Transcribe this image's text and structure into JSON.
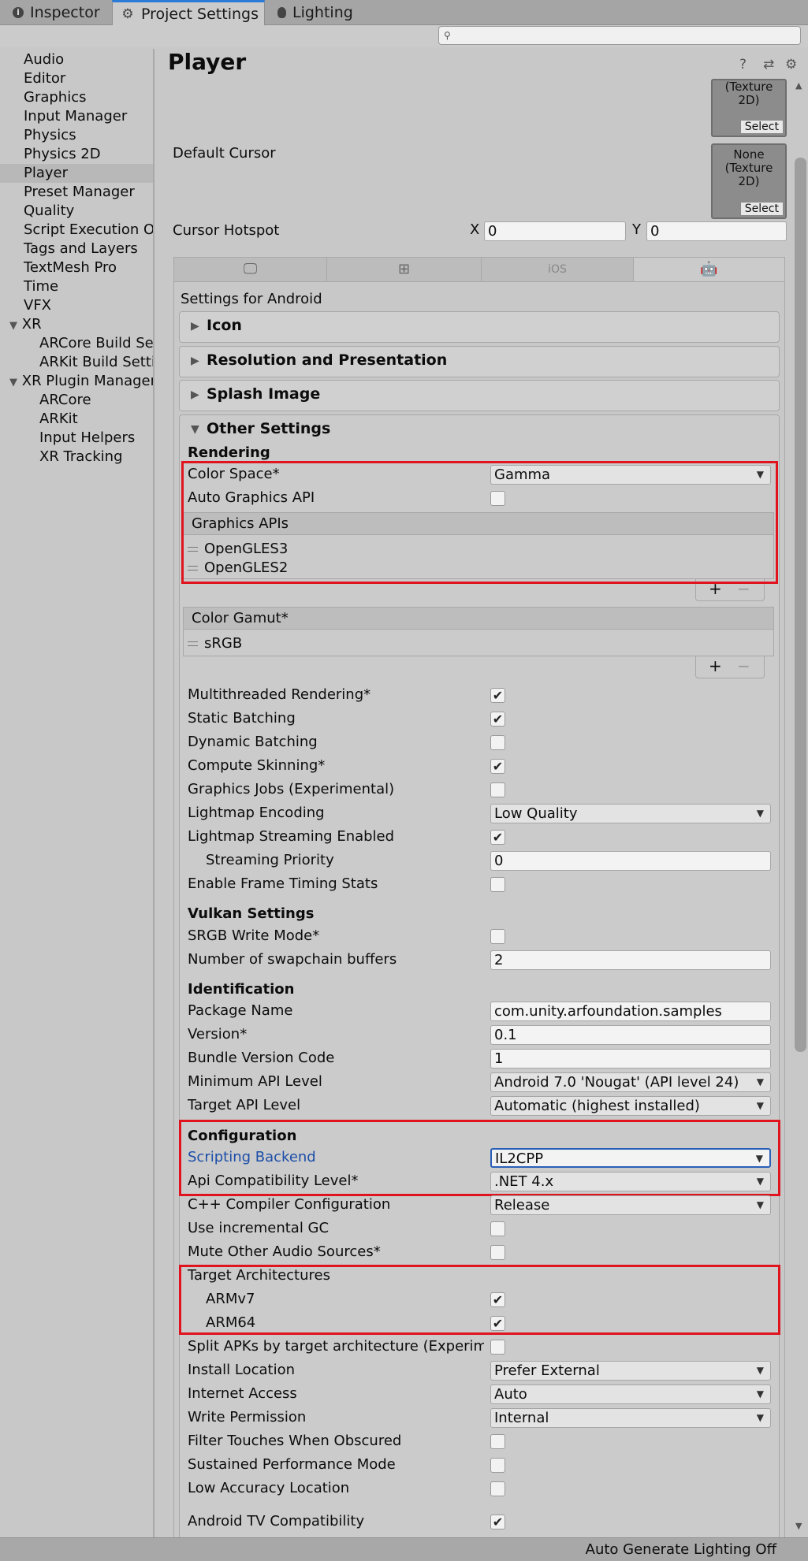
{
  "tabs": [
    {
      "label": "Inspector",
      "icon": "info-icon"
    },
    {
      "label": "Project Settings",
      "icon": "gear-icon"
    },
    {
      "label": "Lighting",
      "icon": "bulb-icon"
    }
  ],
  "search": {
    "placeholder": ""
  },
  "sidebar": {
    "items": [
      "Audio",
      "Editor",
      "Graphics",
      "Input Manager",
      "Physics",
      "Physics 2D",
      "Player",
      "Preset Manager",
      "Quality",
      "Script Execution Or",
      "Tags and Layers",
      "TextMesh Pro",
      "Time",
      "VFX"
    ],
    "xr": {
      "label": "XR",
      "children": [
        "ARCore Build Set",
        "ARKit Build Settin"
      ]
    },
    "xr_plugin": {
      "label": "XR Plugin Manager",
      "children": [
        "ARCore",
        "ARKit",
        "Input Helpers",
        "XR Tracking"
      ]
    },
    "selected": "Player"
  },
  "header": {
    "title": "Player",
    "help": "?",
    "preset": "⇄",
    "settings": "⚙"
  },
  "top": {
    "texture_top": "(Texture 2D)",
    "select": "Select",
    "default_cursor": "Default Cursor",
    "cursor_tex_line1": "None",
    "cursor_tex_line2": "(Texture 2D)",
    "cursor_hotspot": "Cursor Hotspot",
    "x_label": "X",
    "x_value": "0",
    "y_label": "Y",
    "y_value": "0"
  },
  "platform_tabs": [
    "desktop-icon",
    "windows-icon",
    "iOS",
    "android-icon"
  ],
  "settings_for": "Settings for Android",
  "foldouts": {
    "icon": "Icon",
    "resolution": "Resolution and Presentation",
    "splash": "Splash Image",
    "other": "Other Settings"
  },
  "rendering": {
    "header": "Rendering",
    "color_space": {
      "label": "Color Space*",
      "value": "Gamma"
    },
    "auto_graphics": "Auto Graphics API",
    "graphics_apis": {
      "header": "Graphics APIs",
      "items": [
        "OpenGLES3",
        "OpenGLES2"
      ]
    },
    "color_gamut": {
      "header": "Color Gamut*",
      "items": [
        "sRGB"
      ]
    },
    "plus": "+",
    "minus": "−",
    "rows": [
      {
        "label": "Multithreaded Rendering*",
        "checked": true
      },
      {
        "label": "Static Batching",
        "checked": true
      },
      {
        "label": "Dynamic Batching",
        "checked": false
      },
      {
        "label": "Compute Skinning*",
        "checked": true
      },
      {
        "label": "Graphics Jobs (Experimental)",
        "checked": false
      }
    ],
    "lightmap_encoding": {
      "label": "Lightmap Encoding",
      "value": "Low Quality"
    },
    "lightmap_streaming": {
      "label": "Lightmap Streaming Enabled",
      "checked": true
    },
    "streaming_priority": {
      "label": "Streaming Priority",
      "value": "0"
    },
    "frame_timing": {
      "label": "Enable Frame Timing Stats",
      "checked": false
    }
  },
  "vulkan": {
    "header": "Vulkan Settings",
    "srgb": {
      "label": "SRGB Write Mode*",
      "checked": false
    },
    "swapchain": {
      "label": "Number of swapchain buffers",
      "value": "2"
    }
  },
  "identification": {
    "header": "Identification",
    "package": {
      "label": "Package Name",
      "value": "com.unity.arfoundation.samples"
    },
    "version": {
      "label": "Version*",
      "value": "0.1"
    },
    "bundle": {
      "label": "Bundle Version Code",
      "value": "1"
    },
    "min_api": {
      "label": "Minimum API Level",
      "value": "Android 7.0 'Nougat' (API level 24)"
    },
    "target_api": {
      "label": "Target API Level",
      "value": "Automatic (highest installed)"
    }
  },
  "configuration": {
    "header": "Configuration",
    "scripting": {
      "label": "Scripting Backend",
      "value": "IL2CPP"
    },
    "api_compat": {
      "label": "Api Compatibility Level*",
      "value": ".NET 4.x"
    },
    "cpp": {
      "label": "C++ Compiler Configuration",
      "value": "Release"
    },
    "incremental_gc": {
      "label": "Use incremental GC",
      "checked": false
    },
    "mute_audio": {
      "label": "Mute Other Audio Sources*",
      "checked": false
    },
    "target_arch": "Target Architectures",
    "armv7": {
      "label": "ARMv7",
      "checked": true
    },
    "arm64": {
      "label": "ARM64",
      "checked": true
    },
    "split_apks": {
      "label": "Split APKs by target architecture (Experimen",
      "checked": false
    },
    "install_location": {
      "label": "Install Location",
      "value": "Prefer External"
    },
    "internet_access": {
      "label": "Internet Access",
      "value": "Auto"
    },
    "write_permission": {
      "label": "Write Permission",
      "value": "Internal"
    },
    "filter_touches": {
      "label": "Filter Touches When Obscured",
      "checked": false
    },
    "sustained_perf": {
      "label": "Sustained Performance Mode",
      "checked": false
    },
    "low_accuracy": {
      "label": "Low Accuracy Location",
      "checked": false
    },
    "android_tv": {
      "label": "Android TV Compatibility",
      "checked": true
    }
  },
  "check_glyph": "✔",
  "status": {
    "text": "Auto Generate Lighting Off"
  },
  "colors": {
    "highlight_box": "#e0141e",
    "focus_blue": "#2a5fb8",
    "link_blue": "#1c4ea8"
  }
}
